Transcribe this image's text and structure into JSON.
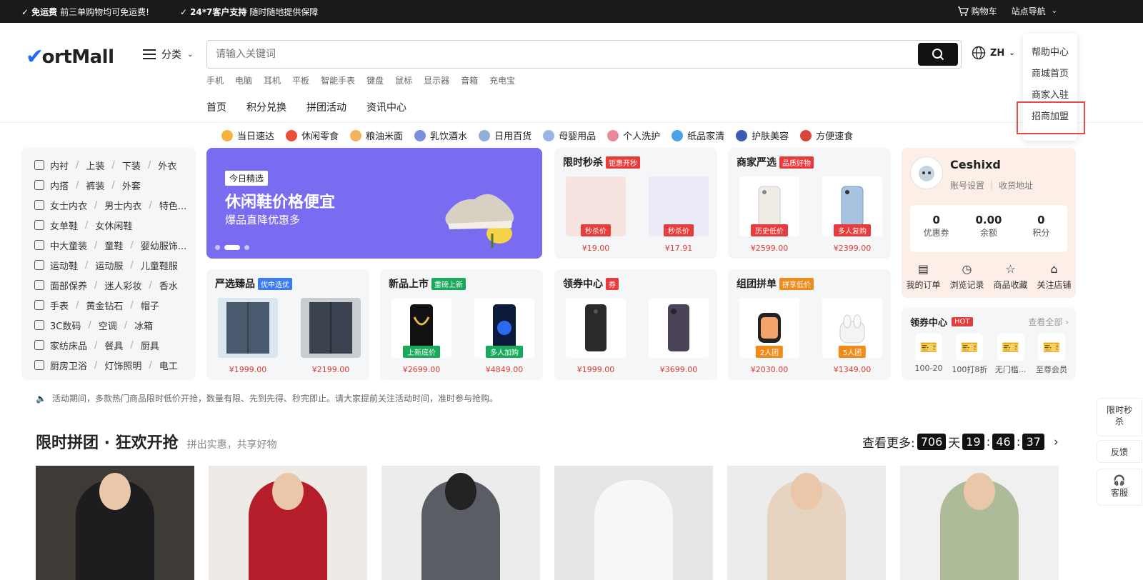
{
  "topbar": {
    "promo1_title": "免运费",
    "promo1_text": "前三单购物均可免运费!",
    "promo2_title": "24*7客户支持",
    "promo2_text": "随时随地提供保障",
    "cart": "购物车",
    "site_nav": "站点导航"
  },
  "header": {
    "logo_text": "ortMall",
    "category_label": "分类",
    "search_placeholder": "请输入关键词",
    "lang": "ZH",
    "hotwords": [
      "手机",
      "电脑",
      "耳机",
      "平板",
      "智能手表",
      "键盘",
      "鼠标",
      "显示器",
      "音箱",
      "充电宝"
    ],
    "nav": [
      "首页",
      "积分兑换",
      "拼团活动",
      "资讯中心"
    ]
  },
  "dropdown": {
    "items": [
      "帮助中心",
      "商城首页",
      "商家入驻",
      "招商加盟"
    ]
  },
  "catbar": {
    "items": [
      "当日速达",
      "休闲零食",
      "粮油米面",
      "乳饮酒水",
      "日用百货",
      "母婴用品",
      "个人洗护",
      "纸品家清",
      "护肤美容",
      "方便速食"
    ],
    "colors": [
      "#f3b53f",
      "#e8503a",
      "#f4b35a",
      "#7a8fe0",
      "#8fb0d9",
      "#9bb4e8",
      "#e98a9a",
      "#4aa3e6",
      "#3b5bb5",
      "#d9433a"
    ]
  },
  "sidebar": {
    "rows": [
      [
        "内衬",
        "上装",
        "下装",
        "外衣"
      ],
      [
        "内搭",
        "裤装",
        "外套"
      ],
      [
        "女士内衣",
        "男士内衣",
        "特色..."
      ],
      [
        "女单鞋",
        "女休闲鞋"
      ],
      [
        "中大童装",
        "童鞋",
        "婴幼服饰..."
      ],
      [
        "运动鞋",
        "运动服",
        "儿童鞋服"
      ],
      [
        "面部保养",
        "迷人彩妆",
        "香水"
      ],
      [
        "手表",
        "黄金钻石",
        "帽子"
      ],
      [
        "3C数码",
        "空调",
        "冰箱"
      ],
      [
        "家纺床品",
        "餐具",
        "厨具"
      ],
      [
        "厨房卫浴",
        "灯饰照明",
        "电工"
      ]
    ]
  },
  "banner": {
    "tag": "今日精选",
    "title": "休闲鞋价格便宜",
    "subtitle": "爆品直降优惠多"
  },
  "cards": {
    "flash": {
      "title": "限时秒杀",
      "badge": "钜惠开秒",
      "items": [
        {
          "pill": "秒杀价",
          "price": "¥19.00"
        },
        {
          "pill": "秒杀价",
          "price": "¥17.91"
        }
      ]
    },
    "strict": {
      "title": "商家严选",
      "badge": "品质好物",
      "items": [
        {
          "pill": "历史低价",
          "price": "¥2599.00"
        },
        {
          "pill": "多人复购",
          "price": "¥2399.00"
        }
      ]
    },
    "premium": {
      "title": "严选臻品",
      "badge": "优中选优",
      "items": [
        {
          "pill": "",
          "price": "¥1999.00"
        },
        {
          "pill": "",
          "price": "¥2199.00"
        }
      ]
    },
    "newarrival": {
      "title": "新品上市",
      "badge": "重磅上新",
      "items": [
        {
          "pill": "上新底价",
          "price": "¥2699.00"
        },
        {
          "pill": "多人加购",
          "price": "¥4849.00"
        }
      ]
    },
    "couponcenter": {
      "title": "领券中心",
      "badge": "券",
      "items": [
        {
          "pill": "",
          "price": "¥1999.00"
        },
        {
          "pill": "",
          "price": "¥3699.00"
        }
      ]
    },
    "group": {
      "title": "组团拼单",
      "badge": "拼享低价",
      "items": [
        {
          "pill": "2人团",
          "price": "¥2030.00"
        },
        {
          "pill": "5人团",
          "price": "¥1349.00"
        }
      ]
    }
  },
  "user": {
    "name": "Ceshixd",
    "account_settings": "账号设置",
    "address": "收货地址",
    "stats": [
      {
        "value": "0",
        "label": "优惠券"
      },
      {
        "value": "0.00",
        "label": "余额"
      },
      {
        "value": "0",
        "label": "积分"
      }
    ],
    "actions": [
      "我的订单",
      "浏览记录",
      "商品收藏",
      "关注店铺"
    ]
  },
  "coupon": {
    "title": "领券中心",
    "hot": "HOT",
    "more": "查看全部",
    "items": [
      "100-20",
      "100打8折",
      "无门槛...",
      "至尊会员"
    ]
  },
  "notice": "活动期间，多款热门商品限时低价开抢，数量有限、先到先得、秒完即止。请大家提前关注活动时间，准时参与抢购。",
  "section": {
    "title": "限时拼团 · 狂欢开抢",
    "subtitle": "拼出实惠，共享好物",
    "more": "查看更多:",
    "days": "706",
    "day_unit": "天",
    "hours": "19",
    "minutes": "46",
    "seconds": "37"
  },
  "float": {
    "flash": "限时秒杀",
    "feedback": "反馈",
    "service": "客服"
  }
}
